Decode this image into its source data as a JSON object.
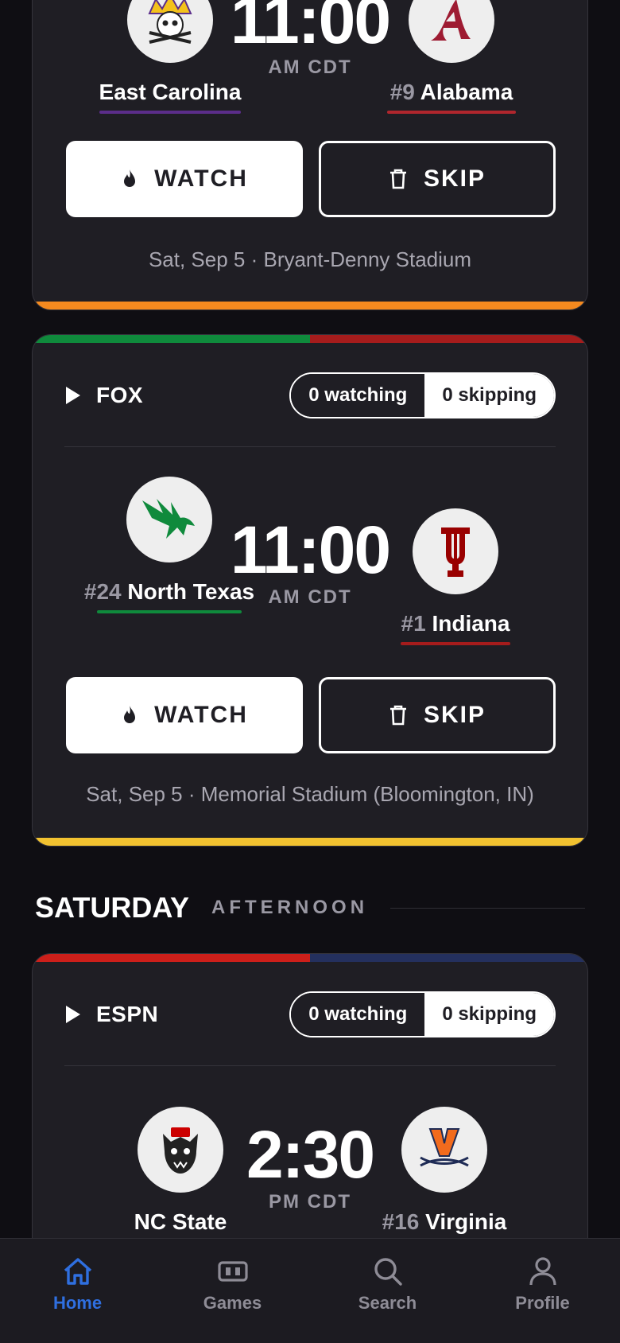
{
  "card1": {
    "away": {
      "rank": "",
      "name": "East Carolina",
      "color": "#5b2d8a"
    },
    "home": {
      "rank": "#9",
      "name": "Alabama",
      "color": "#b0262d"
    },
    "time": "11:00",
    "tz": "AM CDT",
    "watch_label": "WATCH",
    "skip_label": "SKIP",
    "venue": "Sat, Sep 5 · Bryant-Denny Stadium",
    "bottom_color": "#f58a1f"
  },
  "card2": {
    "network": "FOX",
    "watching": "0 watching",
    "skipping": "0 skipping",
    "away": {
      "rank": "#24",
      "name": "North Texas",
      "color": "#0f8a3c"
    },
    "home": {
      "rank": "#1",
      "name": "Indiana",
      "color": "#a51c1c"
    },
    "time": "11:00",
    "tz": "AM CDT",
    "watch_label": "WATCH",
    "skip_label": "SKIP",
    "venue": "Sat, Sep 5 · Memorial Stadium (Bloomington, IN)",
    "bottom_color": "#f2c230"
  },
  "section": {
    "day": "SATURDAY",
    "part": "AFTERNOON"
  },
  "card3": {
    "network": "ESPN",
    "watching": "0 watching",
    "skipping": "0 skipping",
    "away": {
      "rank": "",
      "name": "NC State",
      "color": "#cc1f1a"
    },
    "home": {
      "rank": "#16",
      "name": "Virginia",
      "color": "#24305e"
    },
    "time": "2:30",
    "tz": "PM CDT"
  },
  "tabs": [
    {
      "label": "Home",
      "icon": "home-icon",
      "active": true
    },
    {
      "label": "Games",
      "icon": "games-icon",
      "active": false
    },
    {
      "label": "Search",
      "icon": "search-icon",
      "active": false
    },
    {
      "label": "Profile",
      "icon": "profile-icon",
      "active": false
    }
  ],
  "colors": {
    "accent": "#2f6fe0",
    "card_bg": "#1f1e24",
    "page_bg": "#0f0e13"
  }
}
